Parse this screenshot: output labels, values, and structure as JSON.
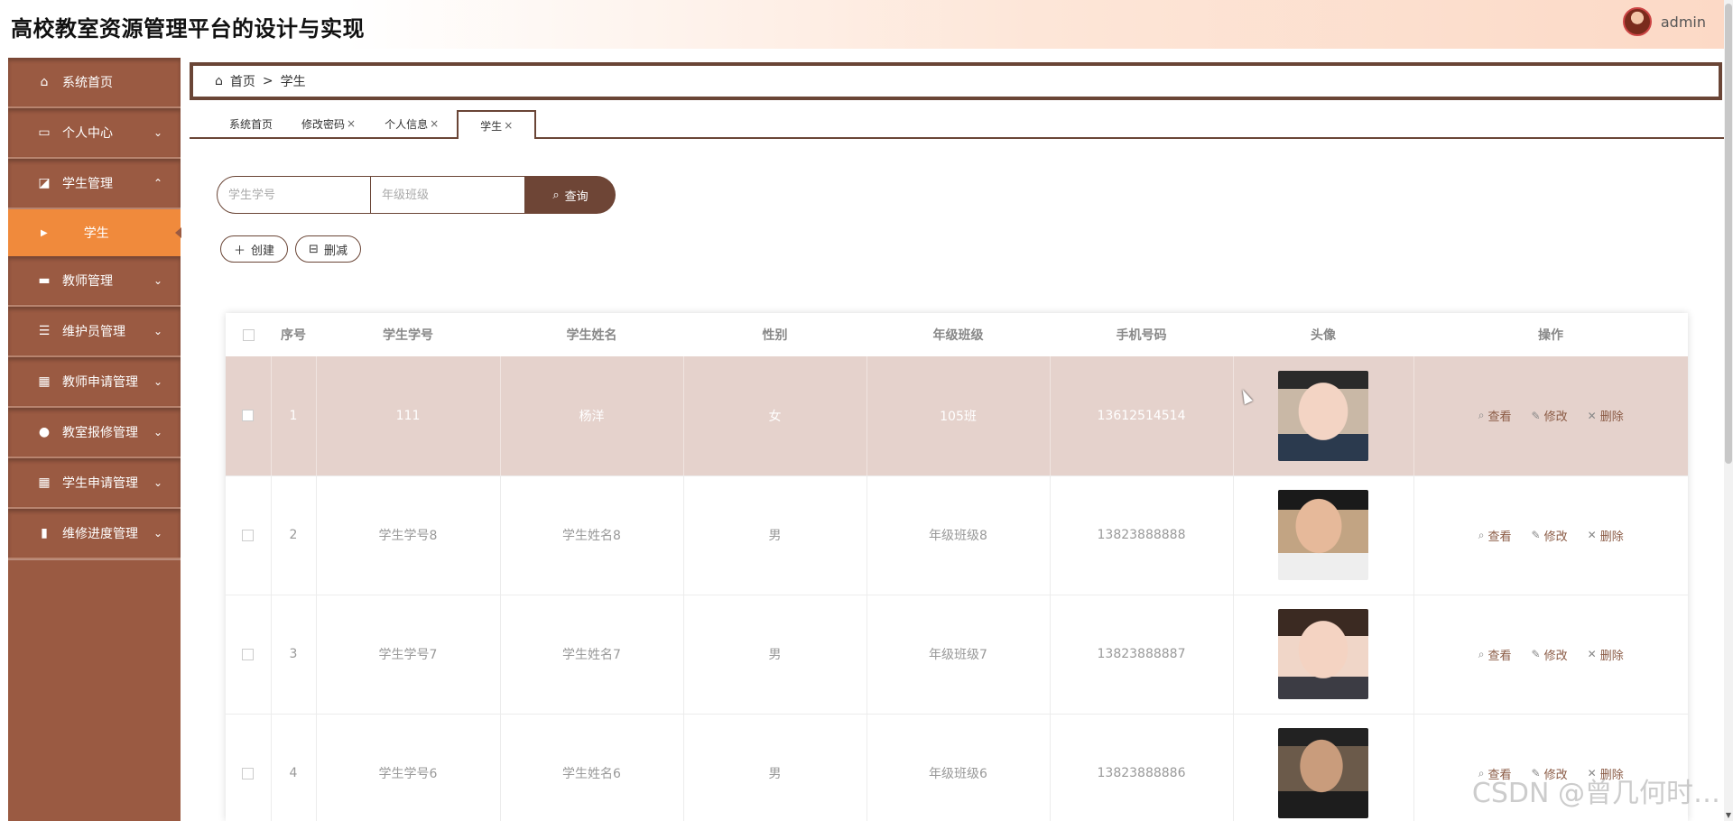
{
  "header": {
    "title": "高校教室资源管理平台的设计与实现",
    "user": "admin"
  },
  "sidebar": {
    "items": [
      {
        "label": "系统首页",
        "icon": "home-icon",
        "glyph": "⌂",
        "chevron": ""
      },
      {
        "label": "个人中心",
        "icon": "profile-card-icon",
        "glyph": "▭",
        "chevron": "⌄"
      },
      {
        "label": "学生管理",
        "icon": "chart-icon",
        "glyph": "◪",
        "chevron": "⌃"
      },
      {
        "label": "教师管理",
        "icon": "printer-icon",
        "glyph": "▬",
        "chevron": "⌄"
      },
      {
        "label": "维护员管理",
        "icon": "list-icon",
        "glyph": "☰",
        "chevron": "⌄"
      },
      {
        "label": "教师申请管理",
        "icon": "grid-icon",
        "glyph": "▦",
        "chevron": "⌄"
      },
      {
        "label": "教室报修管理",
        "icon": "user-icon",
        "glyph": "●",
        "chevron": "⌄"
      },
      {
        "label": "学生申请管理",
        "icon": "grid-icon",
        "glyph": "▦",
        "chevron": "⌄"
      },
      {
        "label": "维修进度管理",
        "icon": "bar-chart-icon",
        "glyph": "▮",
        "chevron": "⌄"
      }
    ],
    "active_sub": "学生"
  },
  "breadcrumb": {
    "home": "首页",
    "separator": ">",
    "current": "学生"
  },
  "tabs": [
    {
      "label": "系统首页",
      "close": ""
    },
    {
      "label": "修改密码",
      "close": "×"
    },
    {
      "label": "个人信息",
      "close": "×"
    },
    {
      "label": "学生",
      "close": "×"
    }
  ],
  "search": {
    "student_no_placeholder": "学生学号",
    "class_placeholder": "年级班级",
    "button": "查询"
  },
  "actions": {
    "create": "创建",
    "delete": "删减"
  },
  "table": {
    "headers": [
      "序号",
      "学生学号",
      "学生姓名",
      "性别",
      "年级班级",
      "手机号码",
      "头像",
      "操作"
    ],
    "rows": [
      {
        "index": "1",
        "no": "111",
        "name": "杨洋",
        "gender": "女",
        "class": "105班",
        "phone": "13612514514"
      },
      {
        "index": "2",
        "no": "学生学号8",
        "name": "学生姓名8",
        "gender": "男",
        "class": "年级班级8",
        "phone": "13823888888"
      },
      {
        "index": "3",
        "no": "学生学号7",
        "name": "学生姓名7",
        "gender": "男",
        "class": "年级班级7",
        "phone": "13823888887"
      },
      {
        "index": "4",
        "no": "学生学号6",
        "name": "学生姓名6",
        "gender": "男",
        "class": "年级班级6",
        "phone": "13823888886"
      }
    ],
    "ops": {
      "view": "查看",
      "edit": "修改",
      "remove": "删除"
    }
  },
  "watermark": "CSDN @曾几何时…"
}
